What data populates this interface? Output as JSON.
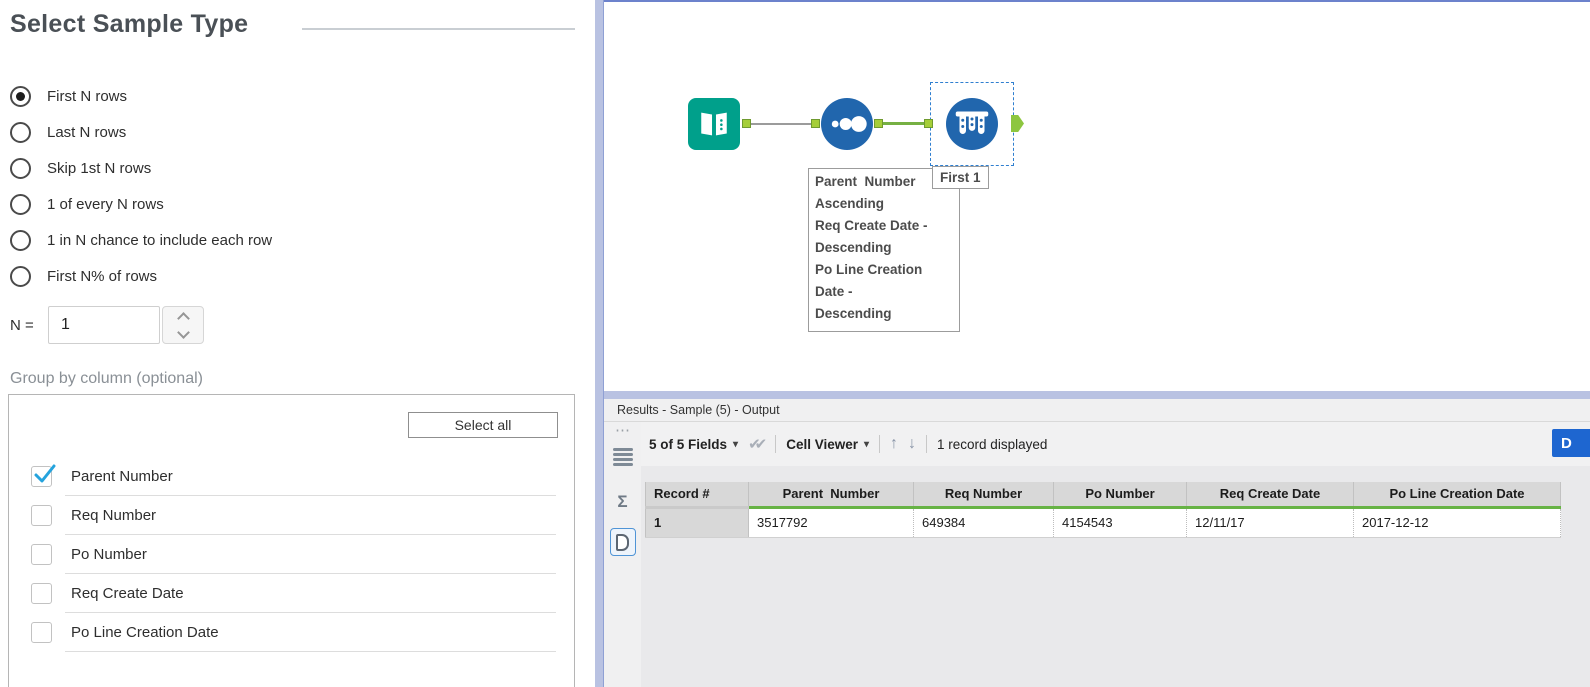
{
  "colors": {
    "tool_teal": "#00a08b",
    "tool_blue": "#2166ad",
    "anchor_green": "#a5ce39",
    "wire_green": "#76b043",
    "header_green": "#67b345",
    "check_blue": "#25a3dd",
    "splitter_blue": "#b9c2e2",
    "selection_blue": "#2f7fd0",
    "d_button_blue": "#1e66d0"
  },
  "config_panel": {
    "title": "Select Sample Type",
    "radio_options": [
      {
        "label": "First N rows",
        "selected": true
      },
      {
        "label": "Last N rows",
        "selected": false
      },
      {
        "label": "Skip 1st N rows",
        "selected": false
      },
      {
        "label": "1 of every N rows",
        "selected": false
      },
      {
        "label": "1 in N chance to include each row",
        "selected": false
      },
      {
        "label": "First N% of rows",
        "selected": false
      }
    ],
    "n_field": {
      "label": "N =",
      "value": "1"
    },
    "group_by": {
      "label": "Group by column (optional)",
      "select_all": "Select all",
      "columns": [
        {
          "label": "Parent Number",
          "checked": true
        },
        {
          "label": "Req Number",
          "checked": false
        },
        {
          "label": "Po Number",
          "checked": false
        },
        {
          "label": "Req Create Date",
          "checked": false
        },
        {
          "label": "Po Line Creation Date",
          "checked": false
        }
      ]
    }
  },
  "canvas": {
    "tools": [
      {
        "name": "input-data-tool"
      },
      {
        "name": "sort-tool"
      },
      {
        "name": "sample-tool",
        "selected": true
      }
    ],
    "sort_annotation_lines": [
      "Parent  Number",
      "Ascending",
      "Req Create Date -",
      "Descending",
      "Po Line Creation",
      "Date -",
      "Descending"
    ],
    "sample_annotation": "First 1"
  },
  "results": {
    "title": "Results - Sample (5) - Output",
    "toolbar": {
      "fields_dropdown": "5 of 5 Fields",
      "cell_viewer_dropdown": "Cell Viewer",
      "record_count": "1 record displayed",
      "data_button": "D"
    },
    "icons": {
      "caret": "▾",
      "double_check": "✔✔",
      "up_arrow": "↑",
      "down_arrow": "↓",
      "dots": "⋯",
      "sigma": "Σ"
    },
    "table": {
      "columns": [
        "Record #",
        "Parent  Number",
        "Req Number",
        "Po Number",
        "Req Create Date",
        "Po Line Creation Date"
      ],
      "rows": [
        {
          "record": "1",
          "values": [
            "3517792",
            "649384",
            "4154543",
            "12/11/17",
            "2017-12-12"
          ]
        }
      ]
    }
  }
}
